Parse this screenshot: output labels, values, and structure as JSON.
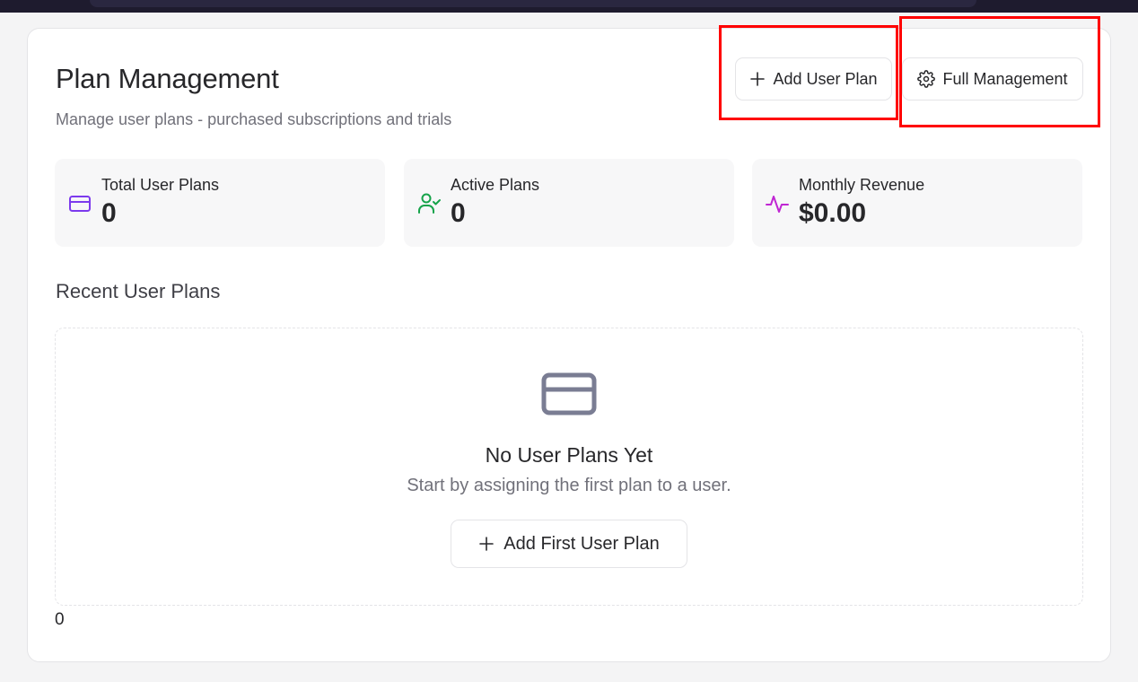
{
  "header": {
    "title": "Plan Management",
    "subtitle": "Manage user plans - purchased subscriptions and trials",
    "add_button_label": "Add User Plan",
    "add_button_icon": "plus-icon",
    "full_button_label": "Full Management",
    "full_button_icon": "gear-icon"
  },
  "stats": [
    {
      "label": "Total User Plans",
      "value": "0",
      "icon": "credit-card-icon",
      "color": "#7c3aed"
    },
    {
      "label": "Active Plans",
      "value": "0",
      "icon": "user-check-icon",
      "color": "#16a34a"
    },
    {
      "label": "Monthly Revenue",
      "value": "$0.00",
      "icon": "activity-icon",
      "color": "#c026d3"
    }
  ],
  "recent": {
    "title": "Recent User Plans",
    "empty_icon": "credit-card-icon",
    "empty_title": "No User Plans Yet",
    "empty_text": "Start by assigning the first plan to a user.",
    "empty_button_label": "Add First User Plan",
    "count": "0"
  },
  "colors": {
    "highlight": "#ff0000",
    "topbar": "#1e1b2e"
  }
}
